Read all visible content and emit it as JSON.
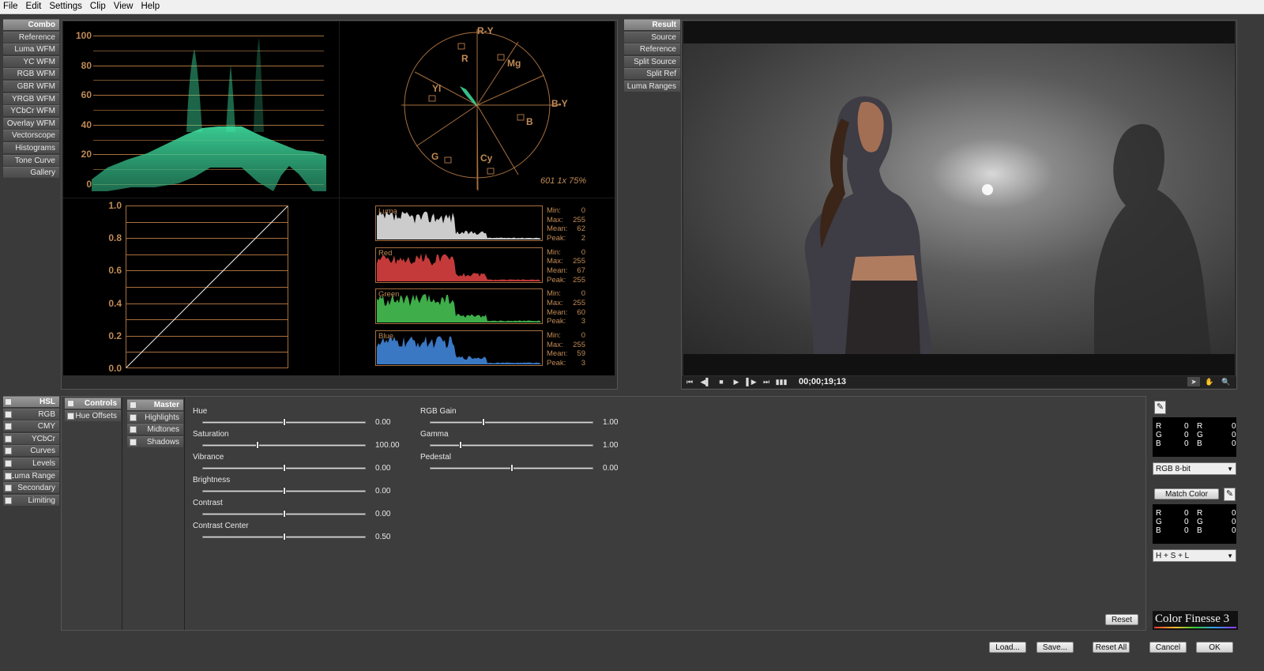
{
  "menu": [
    "File",
    "Edit",
    "Settings",
    "Clip",
    "View",
    "Help"
  ],
  "scope_tabs": [
    "Combo",
    "Reference",
    "Luma WFM",
    "YC WFM",
    "RGB WFM",
    "GBR WFM",
    "YRGB WFM",
    "YCbCr WFM",
    "Overlay WFM",
    "Vectorscope",
    "Histograms",
    "Tone Curve",
    "Gallery"
  ],
  "view_tabs": [
    "Result",
    "Source",
    "Reference",
    "Split Source",
    "Split Ref",
    "Luma Ranges"
  ],
  "waveform": {
    "ticks": [
      "100",
      "80",
      "60",
      "40",
      "20",
      "0"
    ]
  },
  "vectorscope": {
    "labels": {
      "ry": "R-Y",
      "by": "B-Y",
      "r": "R",
      "mg": "Mg",
      "yl": "Yl",
      "b": "B",
      "g": "G",
      "cy": "Cy"
    },
    "readout": "601 1x 75%"
  },
  "tone_curve": {
    "ticks": [
      "1.0",
      "0.8",
      "0.6",
      "0.4",
      "0.2",
      "0.0"
    ]
  },
  "histograms": [
    {
      "name": "Luma",
      "color": "#cccccc",
      "min": "0",
      "max": "255",
      "mean": "62",
      "peak": "2"
    },
    {
      "name": "Red",
      "color": "#c43a3a",
      "min": "0",
      "max": "255",
      "mean": "67",
      "peak": "255"
    },
    {
      "name": "Green",
      "color": "#3fae4a",
      "min": "0",
      "max": "255",
      "mean": "60",
      "peak": "3"
    },
    {
      "name": "Blue",
      "color": "#3a78c4",
      "min": "0",
      "max": "255",
      "mean": "59",
      "peak": "3"
    }
  ],
  "stat_labels": {
    "min": "Min:",
    "max": "Max:",
    "mean": "Mean:",
    "peak": "Peak:"
  },
  "transport": {
    "timecode": "00;00;19;13"
  },
  "correction_tabs": [
    "HSL",
    "RGB",
    "CMY",
    "YCbCr",
    "Curves",
    "Levels",
    "Luma Range",
    "Secondary",
    "Limiting"
  ],
  "control_tabs": [
    "Controls",
    "Hue Offsets"
  ],
  "range_tabs": [
    "Master",
    "Highlights",
    "Midtones",
    "Shadows"
  ],
  "sliders_left": [
    {
      "label": "Hue",
      "value": "0.00",
      "pos": 0.5
    },
    {
      "label": "Saturation",
      "value": "100.00",
      "pos": 0.34
    },
    {
      "label": "Vibrance",
      "value": "0.00",
      "pos": 0.5
    },
    {
      "label": "Brightness",
      "value": "0.00",
      "pos": 0.5
    },
    {
      "label": "Contrast",
      "value": "0.00",
      "pos": 0.5
    },
    {
      "label": "Contrast Center",
      "value": "0.50",
      "pos": 0.5
    }
  ],
  "sliders_right": [
    {
      "label": "RGB Gain",
      "value": "1.00",
      "pos": 0.33
    },
    {
      "label": "Gamma",
      "value": "1.00",
      "pos": 0.19
    },
    {
      "label": "Pedestal",
      "value": "0.00",
      "pos": 0.5
    }
  ],
  "buttons": {
    "reset": "Reset",
    "load": "Load...",
    "save": "Save...",
    "reset_all": "Reset All",
    "cancel": "Cancel",
    "ok": "OK",
    "match_color": "Match Color"
  },
  "sampler": {
    "rows1": [
      [
        "R",
        "0",
        "R",
        "0"
      ],
      [
        "G",
        "0",
        "G",
        "0"
      ],
      [
        "B",
        "0",
        "B",
        "0"
      ]
    ],
    "rows2": [
      [
        "R",
        "0",
        "R",
        "0"
      ],
      [
        "G",
        "0",
        "G",
        "0"
      ],
      [
        "B",
        "0",
        "B",
        "0"
      ]
    ],
    "mode": "RGB 8-bit",
    "match_mode": "H + S + L"
  },
  "brand": "Color Finesse 3"
}
